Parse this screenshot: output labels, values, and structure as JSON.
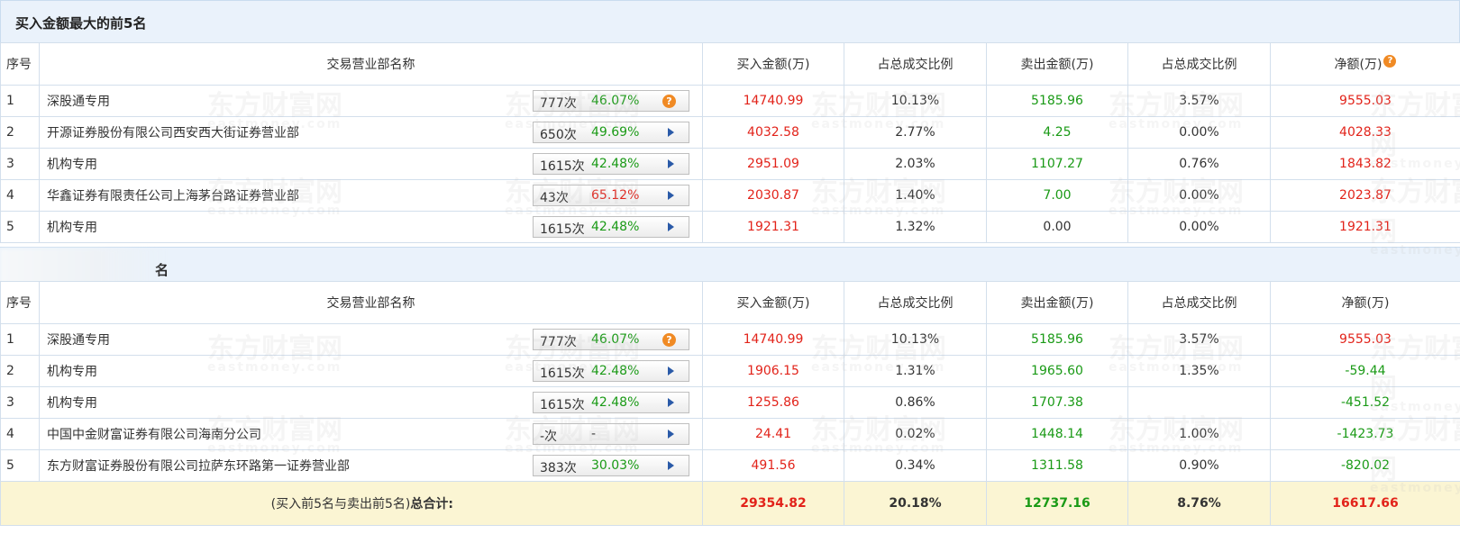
{
  "section1": {
    "title": "买入金额最大的前5名",
    "headers": [
      "序号",
      "交易营业部名称",
      "买入金额(万)",
      "占总成交比例",
      "卖出金额(万)",
      "占总成交比例",
      "净额(万)"
    ],
    "rows": [
      {
        "idx": "1",
        "name": "深股通专用",
        "count": "777次",
        "pct": "46.07%",
        "icon": "question",
        "buy": "14740.99",
        "buy_ratio": "10.13%",
        "sell": "5185.96",
        "sell_ratio": "3.57%",
        "net": "9555.03",
        "net_color": "red",
        "sell_color": "green"
      },
      {
        "idx": "2",
        "name": "开源证券股份有限公司西安西大街证券营业部",
        "count": "650次",
        "pct": "49.69%",
        "icon": "arrow",
        "buy": "4032.58",
        "buy_ratio": "2.77%",
        "sell": "4.25",
        "sell_ratio": "0.00%",
        "net": "4028.33",
        "net_color": "red",
        "sell_color": "green"
      },
      {
        "idx": "3",
        "name": "机构专用",
        "count": "1615次",
        "pct": "42.48%",
        "icon": "arrow",
        "buy": "2951.09",
        "buy_ratio": "2.03%",
        "sell": "1107.27",
        "sell_ratio": "0.76%",
        "net": "1843.82",
        "net_color": "red",
        "sell_color": "green"
      },
      {
        "idx": "4",
        "name": "华鑫证券有限责任公司上海茅台路证券营业部",
        "count": "43次",
        "pct": "65.12%",
        "pct_color": "red",
        "icon": "arrow",
        "buy": "2030.87",
        "buy_ratio": "1.40%",
        "sell": "7.00",
        "sell_ratio": "0.00%",
        "net": "2023.87",
        "net_color": "red",
        "sell_color": "green"
      },
      {
        "idx": "5",
        "name": "机构专用",
        "count": "1615次",
        "pct": "42.48%",
        "icon": "arrow",
        "buy": "1921.31",
        "buy_ratio": "1.32%",
        "sell": "0.00",
        "sell_ratio": "0.00%",
        "net": "1921.31",
        "net_color": "red",
        "sell_color": "dark"
      }
    ]
  },
  "section2": {
    "title_visible": "名",
    "headers": [
      "序号",
      "交易营业部名称",
      "买入金额(万)",
      "占总成交比例",
      "卖出金额(万)",
      "占总成交比例",
      "净额(万)"
    ],
    "rows": [
      {
        "idx": "1",
        "name": "深股通专用",
        "count": "777次",
        "pct": "46.07%",
        "icon": "question",
        "buy": "14740.99",
        "buy_ratio": "10.13%",
        "sell": "5185.96",
        "sell_ratio": "3.57%",
        "net": "9555.03",
        "net_color": "red",
        "sell_color": "green"
      },
      {
        "idx": "2",
        "name": "机构专用",
        "count": "1615次",
        "pct": "42.48%",
        "icon": "arrow",
        "buy": "1906.15",
        "buy_ratio": "1.31%",
        "sell": "1965.60",
        "sell_ratio": "1.35%",
        "net": "-59.44",
        "net_color": "green",
        "sell_color": "green"
      },
      {
        "idx": "3",
        "name": "机构专用",
        "count": "1615次",
        "pct": "42.48%",
        "icon": "arrow",
        "buy": "1255.86",
        "buy_ratio": "0.86%",
        "sell": "1707.38",
        "sell_ratio": "",
        "net": "-451.52",
        "net_color": "green",
        "sell_color": "green"
      },
      {
        "idx": "4",
        "name": "中国中金财富证券有限公司海南分公司",
        "count": "-次",
        "pct": "-",
        "pct_color": "dark",
        "icon": "arrow",
        "buy": "24.41",
        "buy_ratio": "0.02%",
        "sell": "1448.14",
        "sell_ratio": "1.00%",
        "net": "-1423.73",
        "net_color": "green",
        "sell_color": "green"
      },
      {
        "idx": "5",
        "name": "东方财富证券股份有限公司拉萨东环路第一证券营业部",
        "count": "383次",
        "pct": "30.03%",
        "icon": "arrow",
        "buy": "491.56",
        "buy_ratio": "0.34%",
        "sell": "1311.58",
        "sell_ratio": "0.90%",
        "net": "-820.02",
        "net_color": "green",
        "sell_color": "green"
      }
    ],
    "total": {
      "label_prefix": "(买入前5名与卖出前5名)",
      "label_bold": "总合计:",
      "buy": "29354.82",
      "buy_ratio": "20.18%",
      "sell": "12737.16",
      "sell_ratio": "8.76%",
      "net": "16617.66"
    }
  },
  "watermark": {
    "cn": "东方财富网",
    "en": "eastmoney.com"
  },
  "colors": {
    "header_bg": "#eaf2fb",
    "border": "#d3dfec",
    "red": "#e2231a",
    "green": "#1a9a16",
    "total_bg": "#fbf5d3",
    "help_icon": "#f08a24",
    "arrow": "#2a5aa8"
  }
}
